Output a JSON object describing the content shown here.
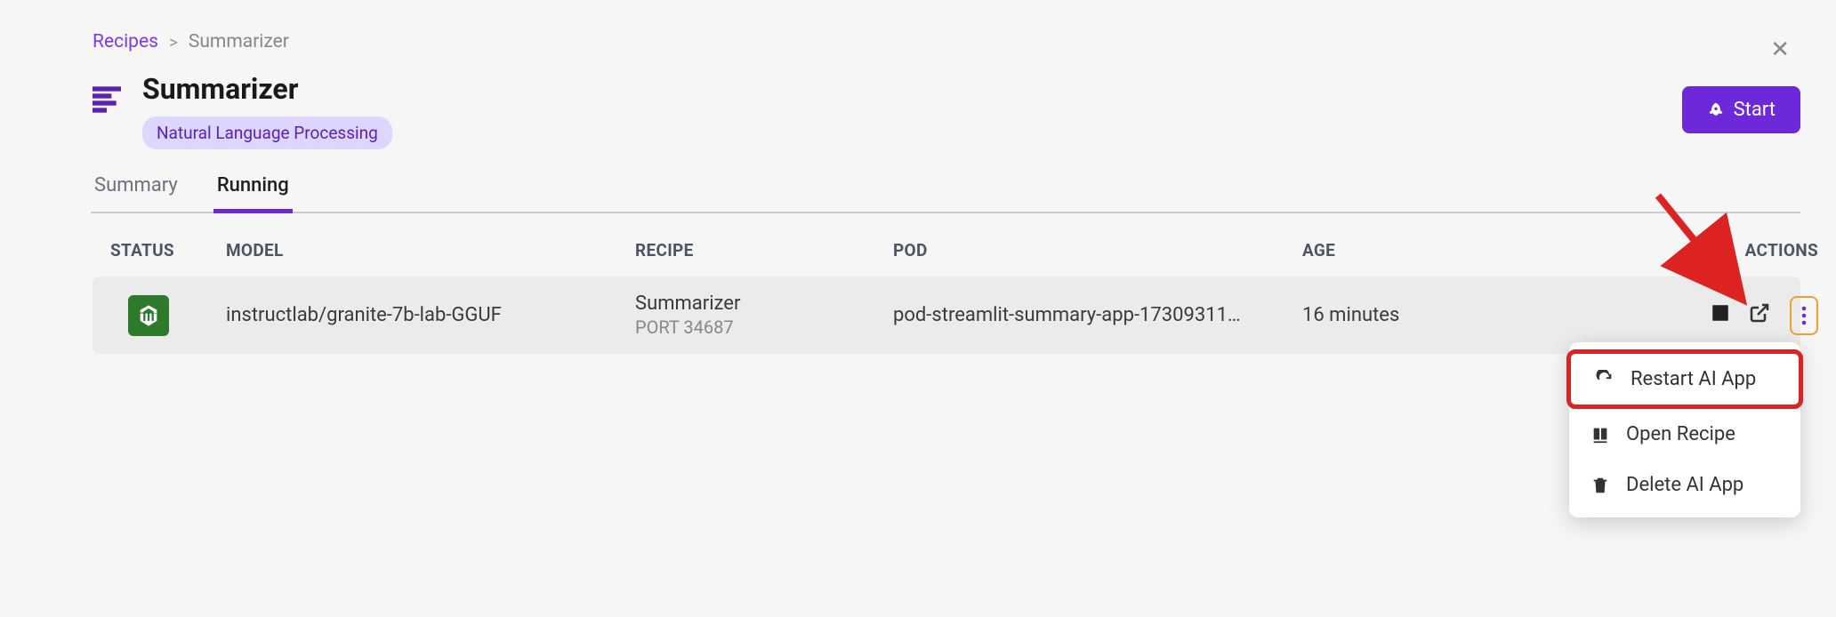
{
  "breadcrumb": {
    "parent": "Recipes",
    "current": "Summarizer"
  },
  "header": {
    "title": "Summarizer",
    "tag": "Natural Language Processing",
    "start_label": "Start"
  },
  "tabs": {
    "summary": "Summary",
    "running": "Running"
  },
  "columns": {
    "status": "STATUS",
    "model": "MODEL",
    "recipe": "RECIPE",
    "pod": "POD",
    "age": "AGE",
    "actions": "ACTIONS"
  },
  "row": {
    "model": "instructlab/granite-7b-lab-GGUF",
    "recipe_name": "Summarizer",
    "recipe_port": "PORT 34687",
    "pod": "pod-streamlit-summary-app-17309311…",
    "age": "16 minutes"
  },
  "menu": {
    "restart": "Restart AI App",
    "open": "Open Recipe",
    "delete": "Delete AI App"
  }
}
